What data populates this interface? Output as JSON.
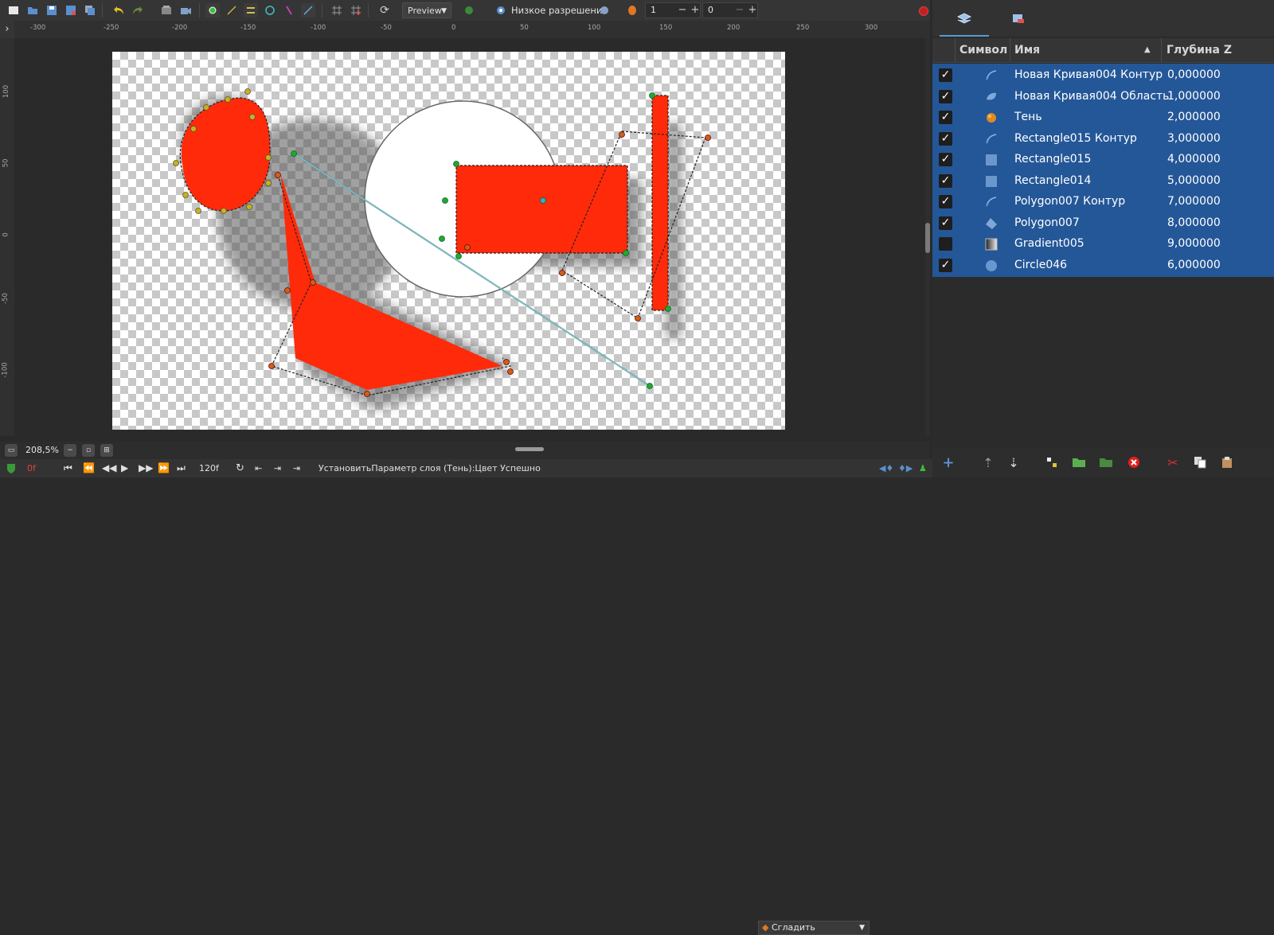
{
  "toolbar": {
    "preview_label": "Preview",
    "lowres_label": "Низкое разрешение",
    "spin1_value": "1",
    "spin2_value": "0"
  },
  "ruler": {
    "h_labels": [
      "-300",
      "-250",
      "-200",
      "-150",
      "-100",
      "-50",
      "0",
      "50",
      "100",
      "150",
      "200",
      "250",
      "300"
    ],
    "v_labels": [
      "100",
      "50",
      "0",
      "-50",
      "-100"
    ]
  },
  "zoom": {
    "value": "208,5%"
  },
  "status": {
    "frame": "0f",
    "end_frame": "120f",
    "message": "УстановитьПараметр слоя (Тень):Цвет Успешно",
    "blend": "Сгладить"
  },
  "layers": {
    "headers": {
      "symbol": "Символ",
      "name": "Имя",
      "depth": "Глубина Z"
    },
    "rows": [
      {
        "name": "Новая Кривая004 Контур",
        "depth": "0,000000",
        "checked": true,
        "icon": "outline-icon"
      },
      {
        "name": "Новая Кривая004 Область",
        "depth": "1,000000",
        "checked": true,
        "icon": "region-icon"
      },
      {
        "name": "Тень",
        "depth": "2,000000",
        "checked": true,
        "icon": "shade-icon"
      },
      {
        "name": "Rectangle015 Контур",
        "depth": "3,000000",
        "checked": true,
        "icon": "outline-icon"
      },
      {
        "name": "Rectangle015",
        "depth": "4,000000",
        "checked": true,
        "icon": "rectangle-icon"
      },
      {
        "name": "Rectangle014",
        "depth": "5,000000",
        "checked": true,
        "icon": "rectangle-icon"
      },
      {
        "name": "Polygon007 Контур",
        "depth": "7,000000",
        "checked": true,
        "icon": "outline-icon"
      },
      {
        "name": "Polygon007",
        "depth": "8,000000",
        "checked": true,
        "icon": "polygon-icon"
      },
      {
        "name": "Gradient005",
        "depth": "9,000000",
        "checked": false,
        "icon": "gradient-icon"
      },
      {
        "name": "Circle046",
        "depth": "6,000000",
        "checked": true,
        "icon": "circle-icon"
      }
    ]
  },
  "colors": {
    "accent": "#245798",
    "shape_fill": "#ff2a0a",
    "vertex_green": "#22aa22",
    "vertex_orange": "#d06010"
  }
}
